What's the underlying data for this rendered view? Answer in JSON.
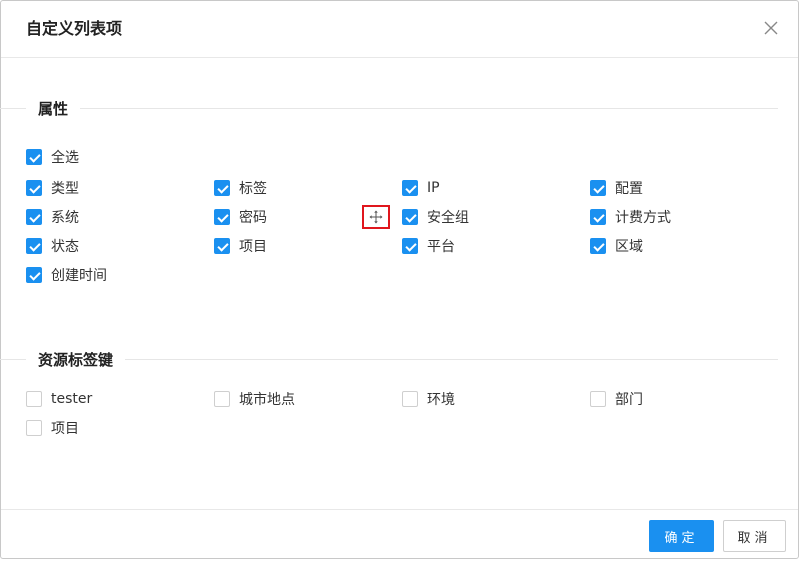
{
  "dialog": {
    "title": "自定义列表项",
    "close_symbol": "×"
  },
  "attributes": {
    "heading": "属性",
    "select_all": {
      "label": "全选",
      "checked": true
    },
    "items": [
      {
        "label": "类型",
        "checked": true
      },
      {
        "label": "标签",
        "checked": true
      },
      {
        "label": "IP",
        "checked": true
      },
      {
        "label": "配置",
        "checked": true
      },
      {
        "label": "系统",
        "checked": true
      },
      {
        "label": "密码",
        "checked": true
      },
      {
        "label": "安全组",
        "checked": true
      },
      {
        "label": "计费方式",
        "checked": true
      },
      {
        "label": "状态",
        "checked": true
      },
      {
        "label": "项目",
        "checked": true
      },
      {
        "label": "平台",
        "checked": true
      },
      {
        "label": "区域",
        "checked": true
      },
      {
        "label": "创建时间",
        "checked": true
      }
    ]
  },
  "resource_tags": {
    "heading": "资源标签键",
    "items": [
      {
        "label": "tester",
        "checked": false
      },
      {
        "label": "城市地点",
        "checked": false
      },
      {
        "label": "环境",
        "checked": false
      },
      {
        "label": "部门",
        "checked": false
      },
      {
        "label": "项目",
        "checked": false
      }
    ]
  },
  "footer": {
    "ok_label": "确定",
    "cancel_label": "取消"
  },
  "colors": {
    "accent": "#1a90f0",
    "highlight": "#e0161d"
  },
  "icons": {
    "close": "close-icon",
    "move": "move-icon",
    "check": "check-icon"
  }
}
